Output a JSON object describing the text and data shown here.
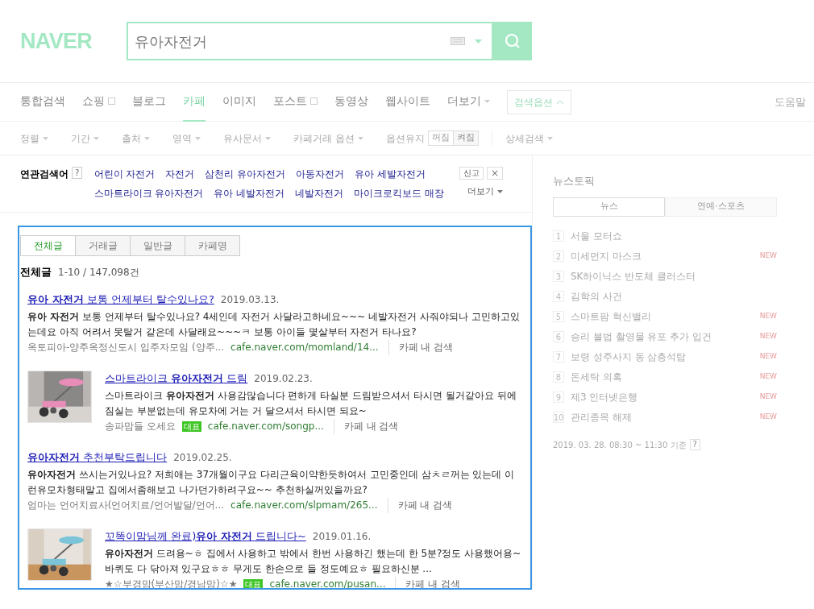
{
  "logo": "NAVER",
  "search": {
    "value": "유아자전거"
  },
  "nav": {
    "tabs": [
      {
        "label": "통합검색",
        "selected": false,
        "has_icon": false,
        "caret": false
      },
      {
        "label": "쇼핑",
        "selected": false,
        "has_icon": true,
        "caret": false
      },
      {
        "label": "블로그",
        "selected": false,
        "has_icon": false,
        "caret": false
      },
      {
        "label": "카페",
        "selected": true,
        "has_icon": false,
        "caret": false
      },
      {
        "label": "이미지",
        "selected": false,
        "has_icon": false,
        "caret": false
      },
      {
        "label": "포스트",
        "selected": false,
        "has_icon": true,
        "caret": false
      },
      {
        "label": "동영상",
        "selected": false,
        "has_icon": false,
        "caret": false
      },
      {
        "label": "웹사이트",
        "selected": false,
        "has_icon": false,
        "caret": false
      },
      {
        "label": "더보기",
        "selected": false,
        "has_icon": false,
        "caret": true
      }
    ],
    "options_button": {
      "label": "검색옵션",
      "expanded": true
    },
    "help": "도움말"
  },
  "filters": {
    "items": [
      "정렬",
      "기간",
      "출처",
      "영역",
      "유사문서",
      "카페거래 옵션"
    ],
    "keep": {
      "label": "옵션유지",
      "options": [
        {
          "label": "꺼짐",
          "selected": true
        },
        {
          "label": "켜짐",
          "selected": false
        }
      ]
    },
    "detail": "상세검색"
  },
  "related": {
    "label": "연관검색어",
    "help": "?",
    "keywords": [
      "어린이 자전거",
      "자전거",
      "삼천리 유아자전거",
      "아동자전거",
      "유아 세발자전거",
      "스마트라이크 유아자전거",
      "유아 네발자전거",
      "네발자전거",
      "마이크로킥보드 매장"
    ],
    "report": "신고",
    "close": "×",
    "more": "더보기"
  },
  "results": {
    "tabs": [
      {
        "label": "전체글",
        "selected": true
      },
      {
        "label": "거래글",
        "selected": false
      },
      {
        "label": "일반글",
        "selected": false
      },
      {
        "label": "카페명",
        "selected": false
      }
    ],
    "heading": "전체글",
    "count": "1-10 / 147,098건",
    "items": [
      {
        "kind": "text",
        "title": "**유아 자전거** 보통 언제부터 탈수있나요?",
        "date": "2019.03.13.",
        "snippet": "**유아 자전거** 보통 언제부터 탈수있나요? 4세인데 자전거 사달라고하네요~~~ 네발자전거 사줘야되나 고민하고있는데요 아직 어려서 못탈거 같은데 사달래요~~~ㅋ 보통 아이들 몇살부터 자전거 타나요?",
        "source": "옥토피아-양주옥정신도시 입주자모임 (양주...",
        "url": "cafe.naver.com/momland/14...",
        "search_in": "카페 내 검색"
      },
      {
        "kind": "thumb",
        "title": "스마트라이크 **유아자전거** 드림",
        "date": "2019.02.23.",
        "snippet": "스마트라이크 **유아자전거** 사용감많습니다 편하게 타실분 드림받으셔서 타시면 될거같아요 뒤에 짐실는 부분없는데 유모차에 거는 거 달으셔서 타시면 되요~",
        "source": "송파맘들 오세요",
        "badge": "대표",
        "url": "cafe.naver.com/songp...",
        "search_in": "카페 내 검색"
      },
      {
        "kind": "text",
        "title": "**유아자전거** 추천부탁드립니다",
        "date": "2019.02.25.",
        "snippet": "**유아자전거** 쓰시는거있나요? 저희애는 37개월이구요 다리근육이약한듯하여서 고민중인데 삼ㅊㄹ꺼는 있는데 이런유모차형태말고 집에서좀해보고 나가던가하려구요~~ 추천하실꺼있을까요?",
        "source": "엄마는 언어치료사(언어치료/언어발달/언어...",
        "url": "cafe.naver.com/slpmam/265...",
        "search_in": "카페 내 검색"
      },
      {
        "kind": "thumb",
        "title": "꼬똑이맘님께 완료)**유아 자전거** 드립니다~",
        "date": "2019.01.16.",
        "snippet": "**유아자전거** 드려용~ㅎ 집에서 사용하고 밖에서 한번 사용하긴 했는데 한 5분?정도 사용했어용~바퀴도 다 닦아져 있구요ㅎㅎ 무게도 한손으로 들 정도예요ㅎ 필요하신분 ...",
        "source": "★☆부경맘(부산맘/경남맘)☆★",
        "badge": "대표",
        "url": "cafe.naver.com/pusan...",
        "search_in": "카페 내 검색"
      }
    ]
  },
  "news": {
    "title": "뉴스토픽",
    "tabs": [
      {
        "label": "뉴스",
        "selected": true
      },
      {
        "label": "연예·스포츠",
        "selected": false
      }
    ],
    "items": [
      {
        "rank": "1",
        "title": "서울 모터쇼"
      },
      {
        "rank": "2",
        "title": "미세먼지 마스크",
        "badge": "NEW"
      },
      {
        "rank": "3",
        "title": "SK하이닉스 반도체 클러스터"
      },
      {
        "rank": "4",
        "title": "김학의 사건"
      },
      {
        "rank": "5",
        "title": "스마트팜 혁신밸리",
        "badge": "NEW"
      },
      {
        "rank": "6",
        "title": "승리 불법 촬영물 유포 추가 입건",
        "badge": "NEW"
      },
      {
        "rank": "7",
        "title": "보령 성주사지 동 삼층석탑",
        "badge": "NEW"
      },
      {
        "rank": "8",
        "title": "돈세탁 의혹",
        "badge": "NEW"
      },
      {
        "rank": "9",
        "title": "제3 인터넷은행",
        "badge": "NEW"
      },
      {
        "rank": "10",
        "title": "관리종목 해제",
        "badge": "NEW"
      }
    ],
    "timestamp": "2019. 03. 28. 08:30 ~ 11:30 기준",
    "help": "?"
  }
}
